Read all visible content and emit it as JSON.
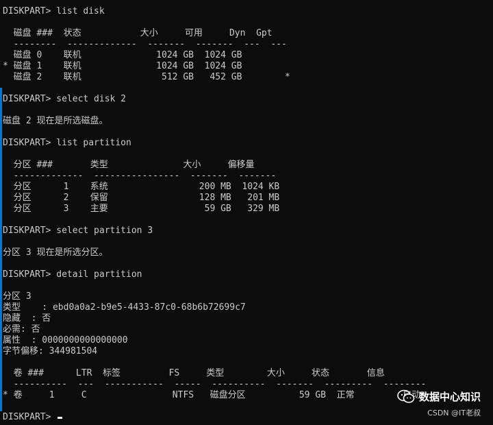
{
  "console": {
    "lines": [
      "DISKPART> list disk",
      "",
      "  磁盘 ###  状态           大小     可用     Dyn  Gpt",
      "  --------  -------------  -------  -------  ---  ---",
      "  磁盘 0    联机              1024 GB  1024 GB",
      "* 磁盘 1    联机              1024 GB  1024 GB",
      "  磁盘 2    联机               512 GB   452 GB        *",
      "",
      "DISKPART> select disk 2",
      "",
      "磁盘 2 现在是所选磁盘。",
      "",
      "DISKPART> list partition",
      "",
      "  分区 ###       类型              大小     偏移量",
      "  -------------  ----------------  -------  -------",
      "  分区      1    系统                 200 MB  1024 KB",
      "  分区      2    保留                 128 MB   201 MB",
      "  分区      3    主要                  59 GB   329 MB",
      "",
      "DISKPART> select partition 3",
      "",
      "分区 3 现在是所选分区。",
      "",
      "DISKPART> detail partition",
      "",
      "分区 3",
      "类型    : ebd0a0a2-b9e5-4433-87c0-68b6b72699c7",
      "隐藏  : 否",
      "必需: 否",
      "属性  : 0000000000000000",
      "字节偏移: 344981504",
      "",
      "  卷 ###      LTR  标签         FS     类型        大小     状态       信息",
      "  ----------  ---  -----------  -----  ----------  -------  ---------  --------",
      "* 卷     1     C                NTFS   磁盘分区          59 GB  正常         启动",
      "",
      "DISKPART> "
    ]
  },
  "watermark": {
    "title": "数据中心知识",
    "subtitle": "CSDN @IT老叔",
    "icon": "wechat-icon"
  },
  "colors": {
    "background": "#0c0c0c",
    "foreground": "#cccccc",
    "accent": "#0078d4"
  }
}
